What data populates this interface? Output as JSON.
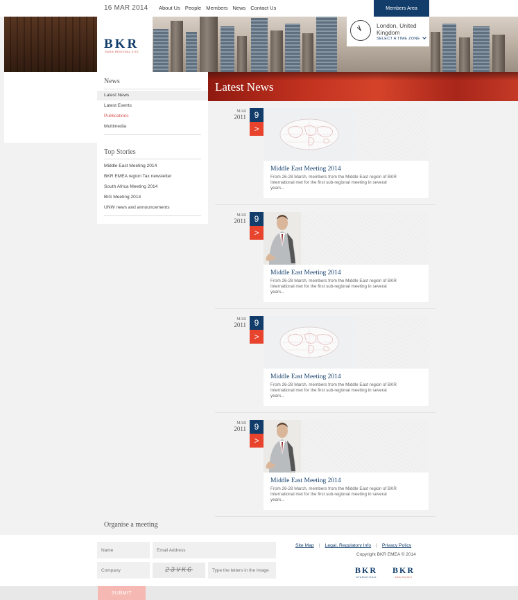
{
  "header": {
    "date": "16 MAR 2014",
    "nav": [
      "About Us",
      "People",
      "Members",
      "News",
      "Contact Us"
    ],
    "members_area": "Members Area"
  },
  "logo": {
    "text": "BKR",
    "subtitle": "EMEA REGIONAL SITE"
  },
  "clock": {
    "city": "London, United Kingdom",
    "timezone_label": "SELECT A TIME ZONE"
  },
  "page_title": "Latest News",
  "sidebar": {
    "news_heading": "News",
    "news_items": [
      {
        "label": "Latest News"
      },
      {
        "label": "Latest Events"
      },
      {
        "label": "Publications"
      },
      {
        "label": "Multimedia"
      }
    ],
    "top_heading": "Top Stories",
    "top_items": [
      {
        "label": "Middle East Meeting 2014"
      },
      {
        "label": "BKR EMEA region Tax newsletter"
      },
      {
        "label": "South Africa Meeting 2014"
      },
      {
        "label": "BIG Meeting 2014"
      },
      {
        "label": "UNW news and announcements"
      }
    ]
  },
  "articles": [
    {
      "month": "MAR",
      "year": "2011",
      "day": "9",
      "image": "world-map",
      "title": "Middle East Meeting 2014",
      "text": "From 26-28 March, members from the Middle East region of BKR International met for the first sub-regional meeting in several years..."
    },
    {
      "month": "MAR",
      "year": "2011",
      "day": "9",
      "image": "businessman",
      "title": "Middle East Meeting 2014",
      "text": "From 26-28 March, members from the Middle East region of BKR International met for the first sub-regional meeting in several years..."
    },
    {
      "month": "MAR",
      "year": "2011",
      "day": "9",
      "image": "world-map",
      "title": "Middle East Meeting 2014",
      "text": "From 26-28 March, members from the Middle East region of BKR International met for the first sub-regional meeting in several years..."
    },
    {
      "month": "MAR",
      "year": "2011",
      "day": "9",
      "image": "businessman",
      "title": "Middle East Meeting 2014",
      "text": "From 26-28 March, members from the Middle East region of BKR International met for the first sub-regional meeting in several years..."
    }
  ],
  "footer": {
    "organise_heading": "Organise a meeting",
    "name_placeholder": "Name",
    "email_placeholder": "Email Address",
    "company_placeholder": "Company",
    "captcha_text": "23VKG",
    "captcha_placeholder": "Type the letters in the image",
    "submit_label": "SUBMIT",
    "links": [
      "Site Map",
      "Legal, Regulatory Info",
      "Privacy Policy"
    ],
    "copyright": "Copyright BKR EMEA © 2014",
    "logo_international": {
      "text": "BKR",
      "sub": "INTERNATIONAL"
    },
    "logo_asia": {
      "text": "BKR",
      "sub": "ASIA PACIFIC"
    }
  },
  "colors": {
    "navy": "#123d6b",
    "accent_red": "#e8432d",
    "submit_pink": "#f6b8b2"
  }
}
